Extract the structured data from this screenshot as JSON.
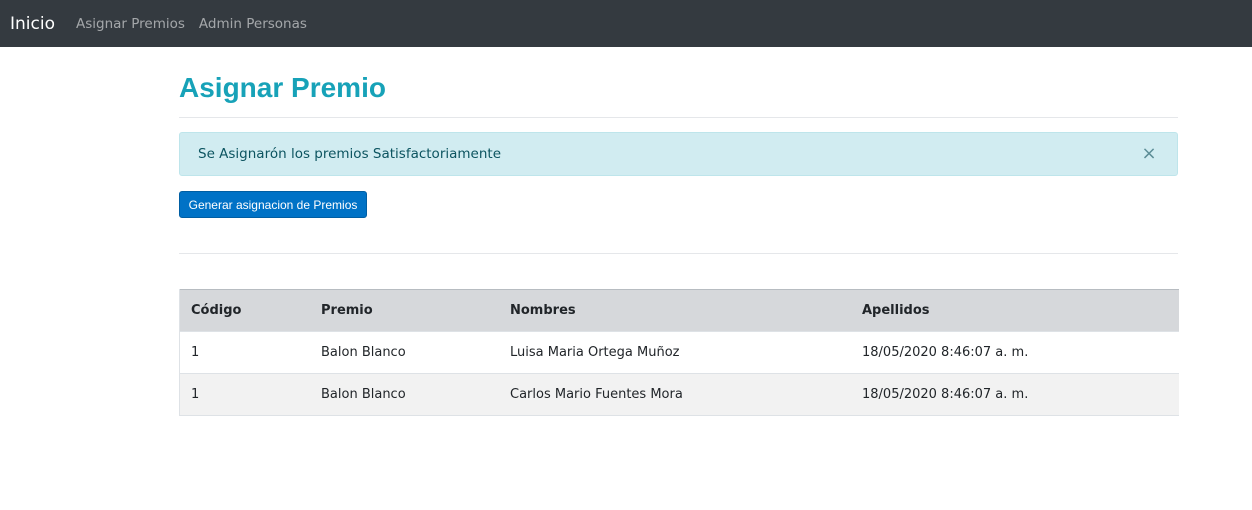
{
  "navbar": {
    "brand": "Inicio",
    "links": [
      "Asignar Premios",
      "Admin Personas"
    ]
  },
  "page": {
    "title": "Asignar Premio"
  },
  "alert": {
    "message": "Se Asignarón los premios Satisfactoriamente",
    "close_symbol": "×"
  },
  "actions": {
    "generate_label": "Generar asignacion de Premios"
  },
  "table": {
    "headers": [
      "Código",
      "Premio",
      "Nombres",
      "Apellidos"
    ],
    "rows": [
      [
        "1",
        "Balon Blanco",
        "Luisa Maria Ortega Muñoz",
        "18/05/2020 8:46:07 a. m."
      ],
      [
        "1",
        "Balon Blanco",
        "Carlos Mario Fuentes Mora",
        "18/05/2020 8:46:07 a. m."
      ]
    ]
  },
  "colors": {
    "navbar_bg": "#343a40",
    "title": "#17a2b8",
    "alert_bg": "#d1ecf1",
    "button_bg": "#0072c6"
  }
}
